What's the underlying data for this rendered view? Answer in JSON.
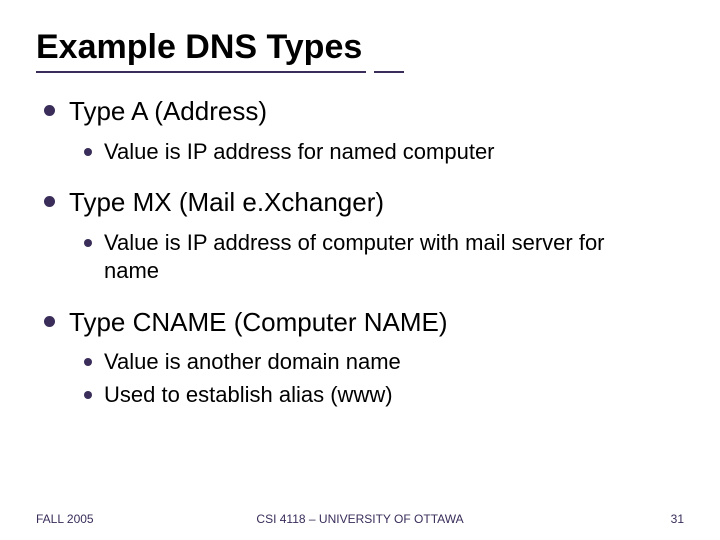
{
  "title": "Example DNS Types",
  "items": [
    {
      "label": "Type A (Address)",
      "sub": [
        "Value is IP address for named computer"
      ]
    },
    {
      "label": "Type MX (Mail e.Xchanger)",
      "sub": [
        "Value is IP address of computer with mail server for name"
      ]
    },
    {
      "label": "Type CNAME (Computer NAME)",
      "sub": [
        "Value is another domain name",
        "Used to establish alias (www)"
      ]
    }
  ],
  "footer": {
    "left": "FALL 2005",
    "center": "CSI 4118 – UNIVERSITY OF OTTAWA",
    "right": "31"
  }
}
